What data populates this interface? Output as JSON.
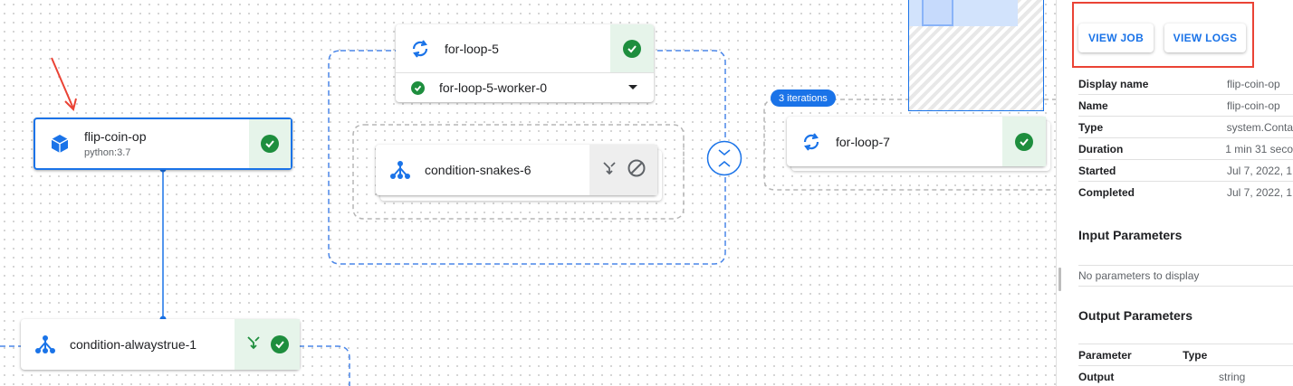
{
  "graph": {
    "flip_coin": {
      "name": "flip-coin-op",
      "subtitle": "python:3.7"
    },
    "for_loop_5": {
      "name": "for-loop-5",
      "worker": "for-loop-5-worker-0"
    },
    "condition_snakes": {
      "name": "condition-snakes-6"
    },
    "for_loop_7": {
      "name": "for-loop-7",
      "badge": "3 iterations"
    },
    "condition_alwaystrue": {
      "name": "condition-alwaystrue-1"
    }
  },
  "colors": {
    "accent": "#1a73e8",
    "success": "#1e8e3e",
    "success_bg": "#e6f4ea",
    "highlight": "#ea4335"
  },
  "panel": {
    "buttons": {
      "view_job": "VIEW JOB",
      "view_logs": "VIEW LOGS"
    },
    "details": [
      {
        "key": "Display name",
        "value": "flip-coin-op"
      },
      {
        "key": "Name",
        "value": "flip-coin-op"
      },
      {
        "key": "Type",
        "value": "system.Conta"
      },
      {
        "key": "Duration",
        "value": "1 min 31 seco"
      },
      {
        "key": "Started",
        "value": "Jul 7, 2022, 1"
      },
      {
        "key": "Completed",
        "value": "Jul 7, 2022, 1"
      }
    ],
    "input_params": {
      "title": "Input Parameters",
      "empty": "No parameters to display"
    },
    "output_params": {
      "title": "Output Parameters",
      "headers": [
        "Parameter",
        "Type"
      ],
      "rows": [
        {
          "parameter": "Output",
          "type": "string"
        }
      ]
    }
  }
}
